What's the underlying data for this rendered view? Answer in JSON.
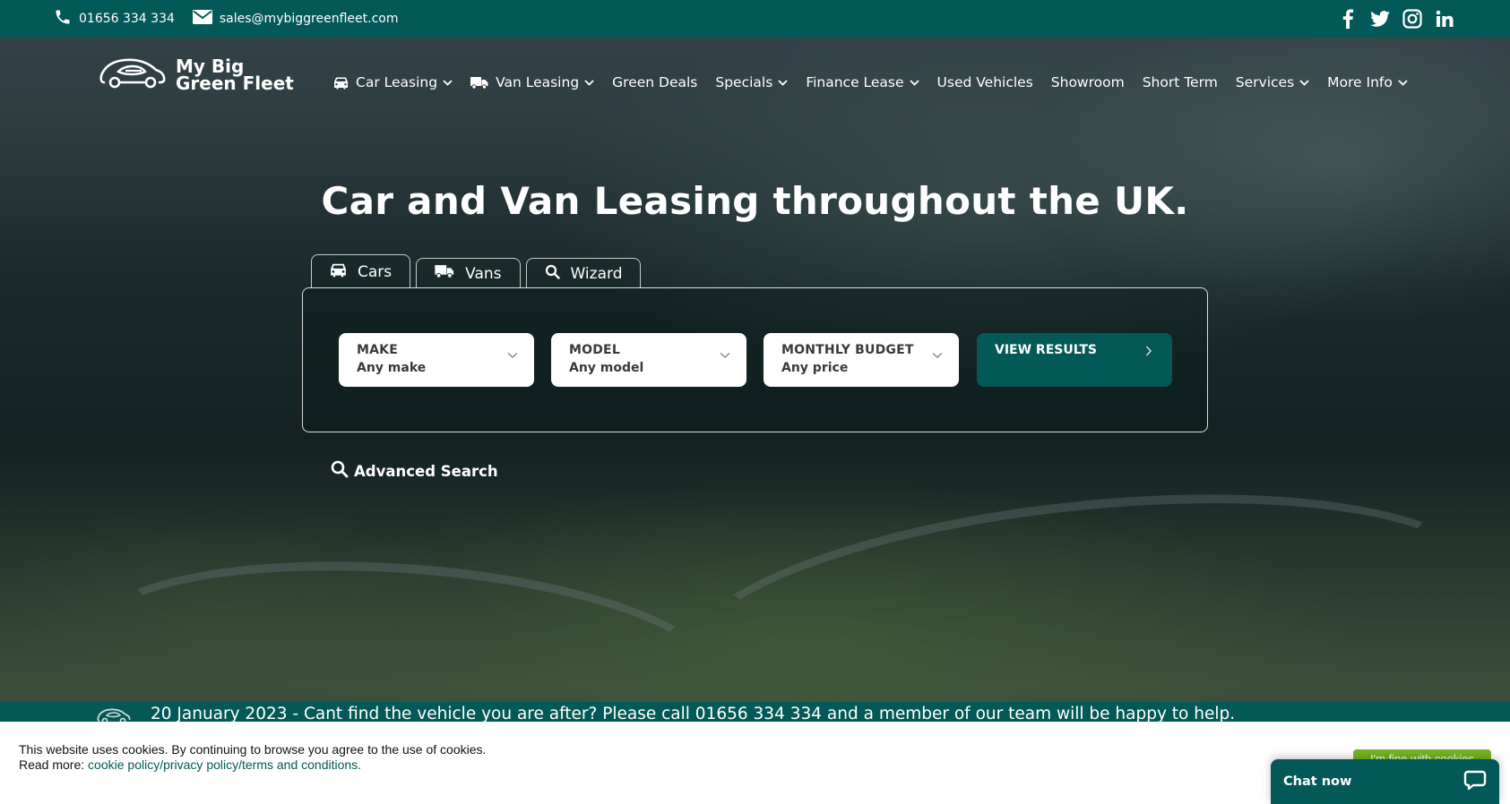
{
  "topbar": {
    "phone": "01656 334 334",
    "email": "sales@mybiggreenfleet.com",
    "social": [
      "facebook-icon",
      "twitter-icon",
      "instagram-icon",
      "linkedin-icon"
    ]
  },
  "brand": {
    "name_line1": "My Big",
    "name_line2": "Green Fleet",
    "primary_color": "#035957",
    "accent_green": "#74b623"
  },
  "nav": {
    "items": [
      {
        "label": "Car Leasing",
        "icon": "car-icon",
        "dropdown": true
      },
      {
        "label": "Van Leasing",
        "icon": "van-icon",
        "dropdown": true
      },
      {
        "label": "Green Deals",
        "dropdown": false
      },
      {
        "label": "Specials",
        "dropdown": true
      },
      {
        "label": "Finance Lease",
        "dropdown": true
      },
      {
        "label": "Used Vehicles",
        "dropdown": false
      },
      {
        "label": "Showroom",
        "dropdown": false
      },
      {
        "label": "Short Term",
        "dropdown": false
      },
      {
        "label": "Services",
        "dropdown": true
      },
      {
        "label": "More Info",
        "dropdown": true
      }
    ]
  },
  "hero": {
    "title": "Car and Van Leasing throughout the UK."
  },
  "search": {
    "tabs": [
      {
        "label": "Cars",
        "icon": "car-icon",
        "active": true
      },
      {
        "label": "Vans",
        "icon": "van-icon",
        "active": false
      },
      {
        "label": "Wizard",
        "icon": "search-icon",
        "active": false
      }
    ],
    "fields": [
      {
        "label": "MAKE",
        "value": "Any make"
      },
      {
        "label": "MODEL",
        "value": "Any model"
      },
      {
        "label": "MONTHLY BUDGET",
        "value": "Any price"
      }
    ],
    "submit_label": "VIEW RESULTS",
    "advanced_label": "Advanced Search"
  },
  "ticker": {
    "message": "20 January 2023 - Cant find the vehicle you are after? Please call 01656 334 334 and a member of our team will be happy to help."
  },
  "cookie": {
    "line1": "This website uses cookies. By continuing to browse you agree to the use of cookies.",
    "read_more": "Read more: ",
    "link_text": "cookie policy/privacy policy/terms and conditions.",
    "accept_label": "I'm fine with cookies"
  },
  "chat": {
    "label": "Chat now"
  }
}
